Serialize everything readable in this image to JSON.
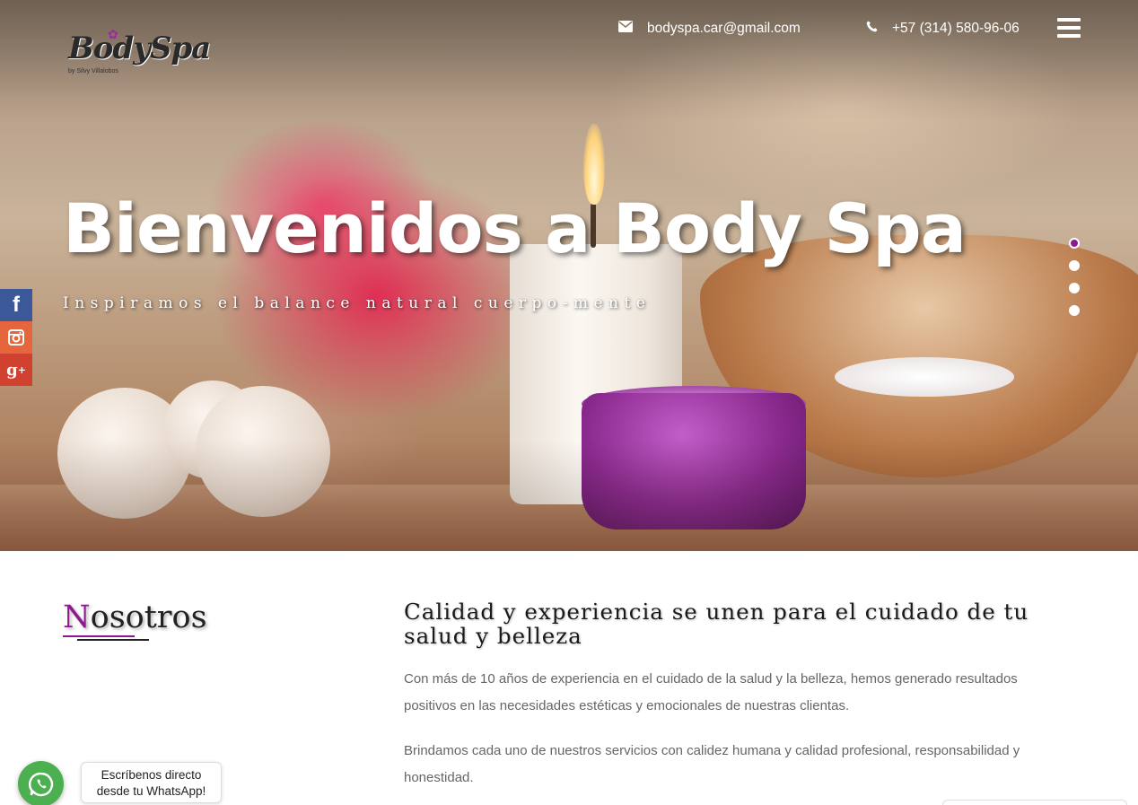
{
  "header": {
    "logo_text": "BodySpa",
    "logo_subtext": "by Silvy Villalobos",
    "email": "bodyspa.car@gmail.com",
    "phone": "+57 (314) 580-96-06"
  },
  "hero": {
    "title": "Bienvenidos a Body Spa",
    "subtitle": "Inspiramos el balance natural cuerpo-mente",
    "slides": 4,
    "active_slide": 1
  },
  "social": [
    "facebook-icon",
    "instagram-icon",
    "google-plus-icon"
  ],
  "about": {
    "title_first": "N",
    "title_rest": "osotros",
    "headline": "Calidad y experiencia se unen para el cuidado de tu salud y belleza",
    "paragraph1": "Con más de 10 años de experiencia en el cuidado de la salud y la belleza, hemos generado resultados positivos en las necesidades estéticas y emocionales de nuestras clientas.",
    "paragraph2": "Brindamos cada uno de nuestros servicios con calidez humana y calidad profesional, responsabilidad y honestidad."
  },
  "whatsapp": {
    "line1": "Escríbenos directo",
    "line2": "desde tu WhatsApp!"
  },
  "colors": {
    "accent": "#8a1a8e",
    "facebook": "#3b5998",
    "instagram": "#e5653d",
    "google_plus": "#d14130",
    "whatsapp": "#4caf50"
  }
}
